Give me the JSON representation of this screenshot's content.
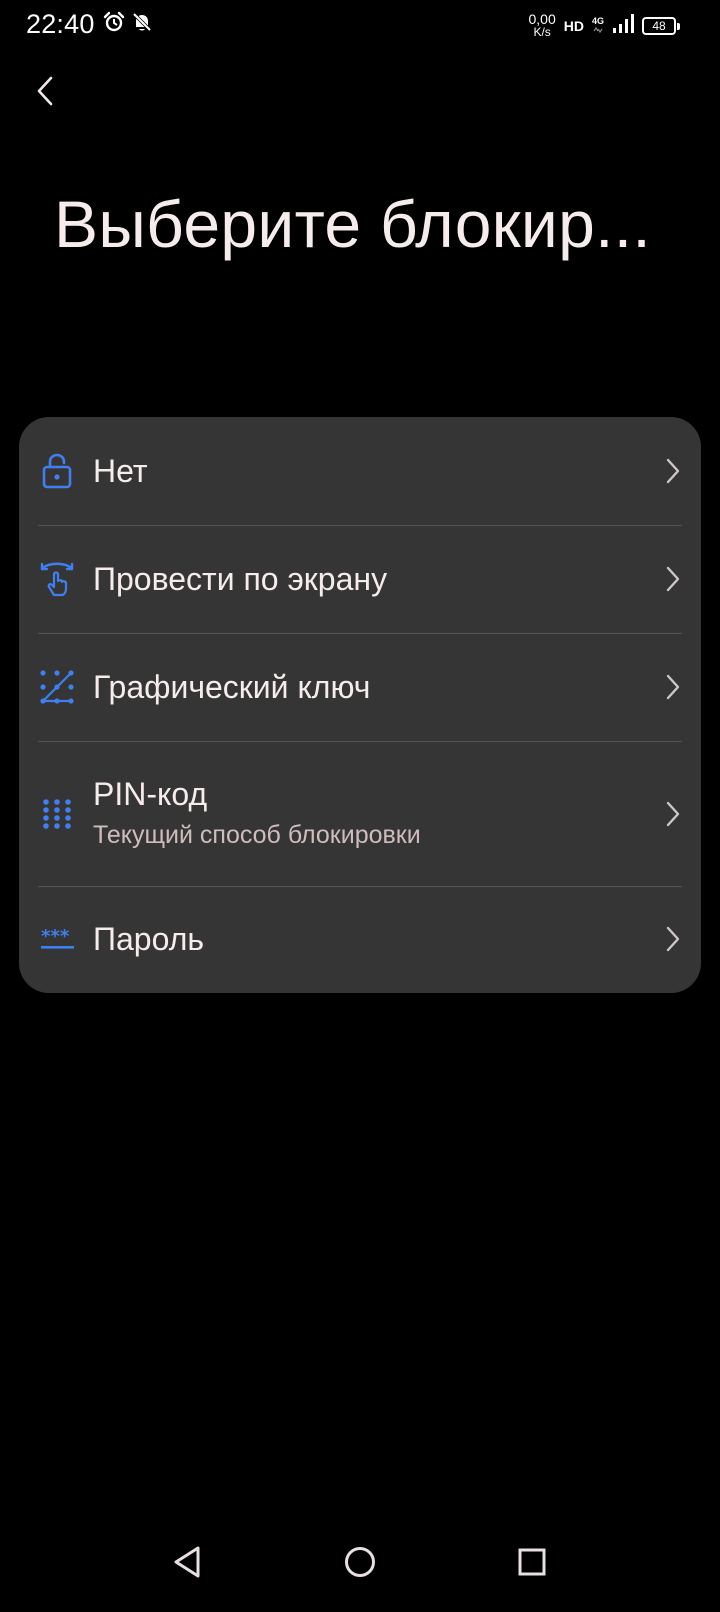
{
  "status_bar": {
    "time": "22:40",
    "net_speed_value": "0,00",
    "net_speed_unit": "K/s",
    "hd": "HD",
    "network": "4G",
    "battery": "48",
    "icons": [
      "alarm-icon",
      "bell-off-icon",
      "signal-icon",
      "battery-icon"
    ]
  },
  "header": {
    "back_icon": "chevron-left-icon",
    "title": "Выберите блокир..."
  },
  "options": [
    {
      "label": "Нет",
      "icon": "unlock-icon"
    },
    {
      "label": "Провести по экрану",
      "icon": "swipe-icon"
    },
    {
      "label": "Графический ключ",
      "icon": "pattern-icon"
    },
    {
      "label": "PIN-код",
      "sub": "Текущий способ блокировки",
      "icon": "pin-icon"
    },
    {
      "label": "Пароль",
      "icon": "password-icon"
    }
  ],
  "colors": {
    "background": "#000000",
    "card": "#353535",
    "accent": "#3f7ff0",
    "text": "#f7ecec",
    "subtext": "#cfbdbd"
  },
  "nav": {
    "icons": [
      "nav-back-icon",
      "nav-home-icon",
      "nav-recents-icon"
    ]
  }
}
